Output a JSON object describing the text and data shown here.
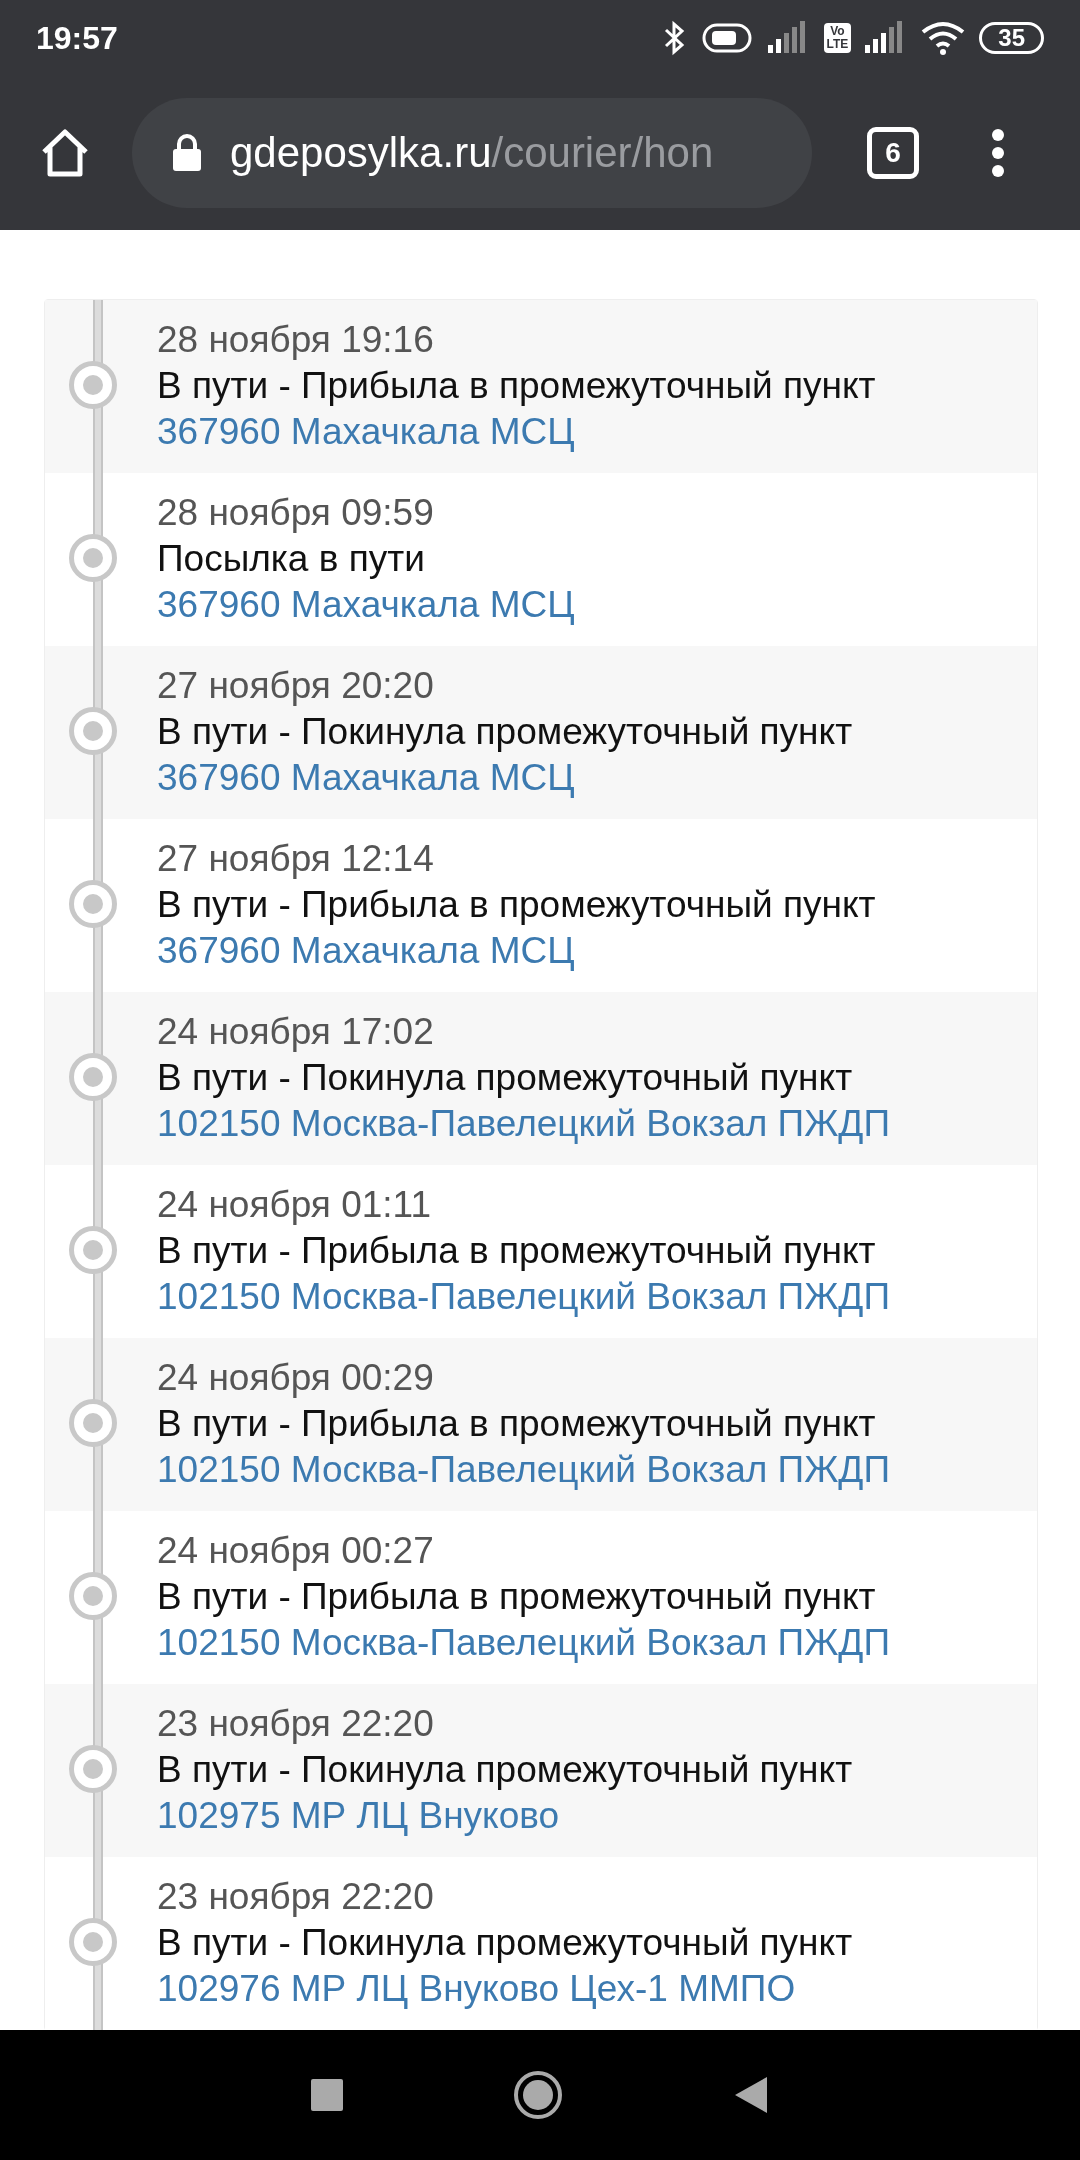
{
  "status_bar": {
    "time": "19:57",
    "volte_top": "Vo",
    "volte_bottom": "LTE",
    "battery": "35"
  },
  "browser": {
    "domain": "gdeposylka.ru",
    "path": "/courier/hon",
    "tab_count": "6"
  },
  "events": [
    {
      "date": "28 ноября 19:16",
      "status": "В пути - Прибыла в промежуточный пункт",
      "location": "367960 Махачкала МСЦ"
    },
    {
      "date": "28 ноября 09:59",
      "status": "Посылка в пути",
      "location": "367960 Махачкала МСЦ"
    },
    {
      "date": "27 ноября 20:20",
      "status": "В пути - Покинула промежуточный пункт",
      "location": "367960 Махачкала МСЦ"
    },
    {
      "date": "27 ноября 12:14",
      "status": "В пути - Прибыла в промежуточный пункт",
      "location": "367960 Махачкала МСЦ"
    },
    {
      "date": "24 ноября 17:02",
      "status": "В пути - Покинула промежуточный пункт",
      "location": "102150 Москва-Павелецкий Вокзал ПЖДП"
    },
    {
      "date": "24 ноября 01:11",
      "status": "В пути - Прибыла в промежуточный пункт",
      "location": "102150 Москва-Павелецкий Вокзал ПЖДП"
    },
    {
      "date": "24 ноября 00:29",
      "status": "В пути - Прибыла в промежуточный пункт",
      "location": "102150 Москва-Павелецкий Вокзал ПЖДП"
    },
    {
      "date": "24 ноября 00:27",
      "status": "В пути - Прибыла в промежуточный пункт",
      "location": "102150 Москва-Павелецкий Вокзал ПЖДП"
    },
    {
      "date": "23 ноября 22:20",
      "status": "В пути - Покинула промежуточный пункт",
      "location": "102975 МР ЛЦ Внуково"
    },
    {
      "date": "23 ноября 22:20",
      "status": "В пути - Покинула промежуточный пункт",
      "location": "102976 МР ЛЦ Внуково Цех-1 ММПО"
    }
  ]
}
